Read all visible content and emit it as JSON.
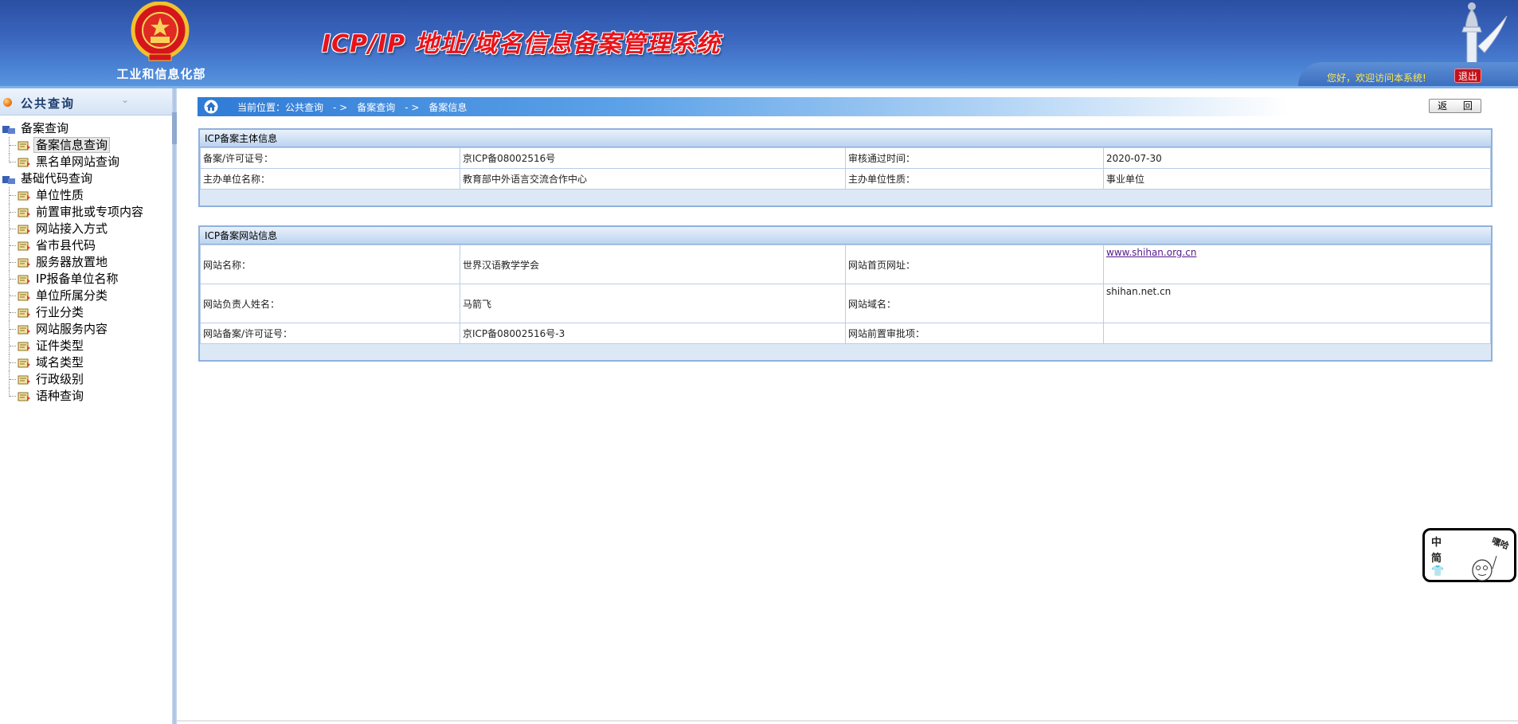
{
  "header": {
    "ministry": "工业和信息化部",
    "title": "ICP/IP 地址/域名信息备案管理系统",
    "welcome": "您好，欢迎访问本系统!",
    "logout": "退出"
  },
  "sidebar": {
    "title": "公共查询",
    "tree": [
      {
        "label": "备案查询",
        "type": "folder"
      },
      {
        "label": "备案信息查询",
        "type": "leaf",
        "selected": true
      },
      {
        "label": "黑名单网站查询",
        "type": "leaf"
      },
      {
        "label": "基础代码查询",
        "type": "folder"
      },
      {
        "label": "单位性质",
        "type": "leaf"
      },
      {
        "label": "前置审批或专项内容",
        "type": "leaf"
      },
      {
        "label": "网站接入方式",
        "type": "leaf"
      },
      {
        "label": "省市县代码",
        "type": "leaf"
      },
      {
        "label": "服务器放置地",
        "type": "leaf"
      },
      {
        "label": "IP报备单位名称",
        "type": "leaf"
      },
      {
        "label": "单位所属分类",
        "type": "leaf"
      },
      {
        "label": "行业分类",
        "type": "leaf"
      },
      {
        "label": "网站服务内容",
        "type": "leaf"
      },
      {
        "label": "证件类型",
        "type": "leaf"
      },
      {
        "label": "域名类型",
        "type": "leaf"
      },
      {
        "label": "行政级别",
        "type": "leaf"
      },
      {
        "label": "语种查询",
        "type": "leaf"
      }
    ]
  },
  "breadcrumb": {
    "text": "当前位置：公共查询　- >　备案查询　- >　备案信息",
    "back": "返 回"
  },
  "subject_panel": {
    "title": "ICP备案主体信息",
    "rows": [
      {
        "k1": "备案/许可证号：",
        "v1": "京ICP备08002516号",
        "k2": "审核通过时间：",
        "v2": "2020-07-30"
      },
      {
        "k1": "主办单位名称：",
        "v1": "教育部中外语言交流合作中心",
        "k2": "主办单位性质：",
        "v2": "事业单位"
      }
    ]
  },
  "site_panel": {
    "title": "ICP备案网站信息",
    "rows": [
      {
        "k1": "网站名称：",
        "v1": "世界汉语教学学会",
        "k2": "网站首页网址：",
        "v2": "www.shihan.org.cn"
      },
      {
        "k1": "网站负责人姓名：",
        "v1": "马箭飞",
        "k2": "网站域名：",
        "v2": "shihan.net.cn"
      },
      {
        "k1": "网站备案/许可证号：",
        "v1": "京ICP备08002516号-3",
        "k2": "网站前置审批项：",
        "v2": ""
      }
    ]
  },
  "widget": {
    "zh": "中",
    "jian": "简",
    "say": "嘿哈"
  },
  "colors": {
    "header_top": "#2a4fa3",
    "header_bottom": "#5c97de",
    "title_red": "#e8131a",
    "welcome_yellow": "#ffe84a",
    "panel_border": "#8fb1dd"
  }
}
